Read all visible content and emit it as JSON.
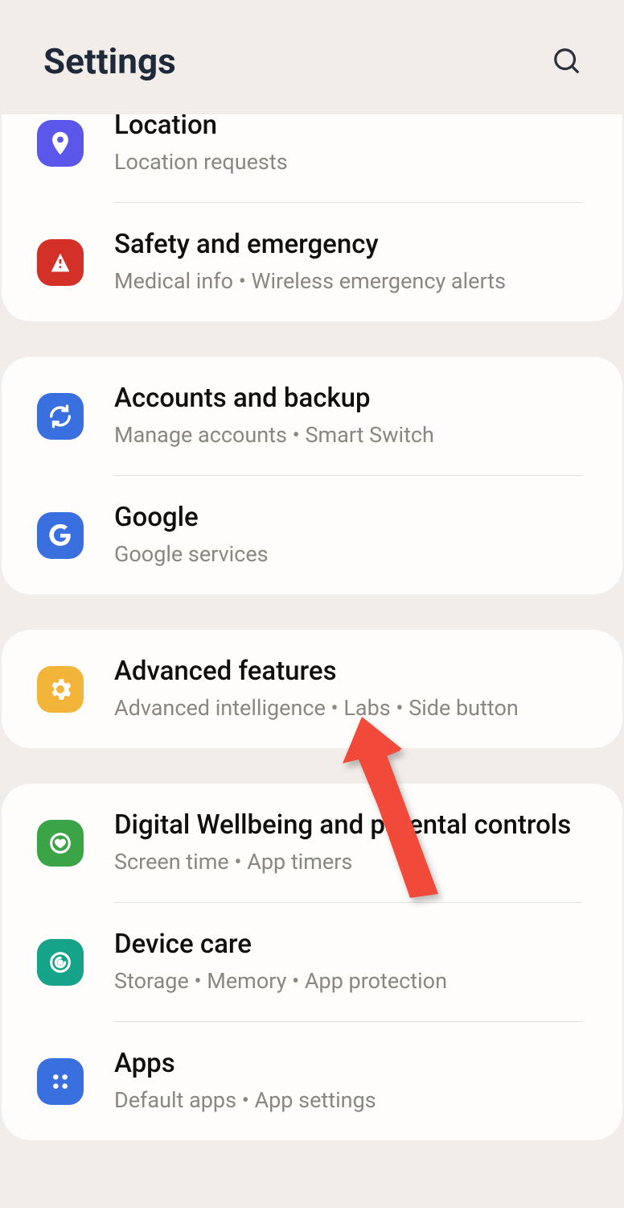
{
  "header": {
    "title": "Settings"
  },
  "groups": [
    {
      "items": [
        {
          "title": "Location",
          "subtitle": "Location requests"
        },
        {
          "title": "Safety and emergency",
          "subtitle": "Medical info  •  Wireless emergency alerts"
        }
      ]
    },
    {
      "items": [
        {
          "title": "Accounts and backup",
          "subtitle": "Manage accounts  •  Smart Switch"
        },
        {
          "title": "Google",
          "subtitle": "Google services"
        }
      ]
    },
    {
      "items": [
        {
          "title": "Advanced features",
          "subtitle": "Advanced intelligence  •  Labs  •  Side button"
        }
      ]
    },
    {
      "items": [
        {
          "title": "Digital Wellbeing and parental controls",
          "subtitle": "Screen time  •  App timers"
        },
        {
          "title": "Device care",
          "subtitle": "Storage  •  Memory  •  App protection"
        },
        {
          "title": "Apps",
          "subtitle": "Default apps  •  App settings"
        }
      ]
    }
  ]
}
